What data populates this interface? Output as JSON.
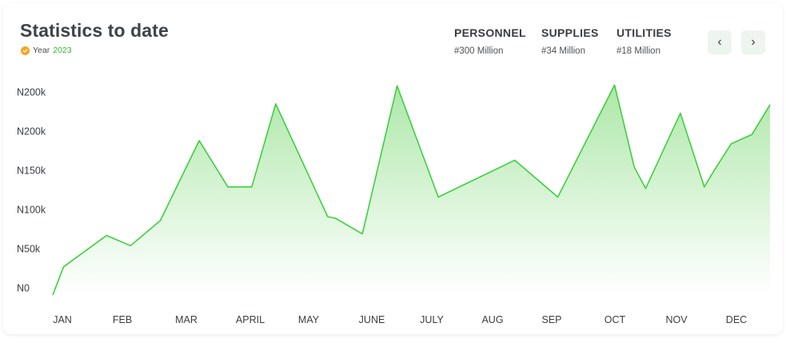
{
  "header": {
    "title": "Statistics to date",
    "year_label": "Year",
    "year_value": "2023"
  },
  "stats": [
    {
      "label": "PERSONNEL",
      "value": "#300 Million"
    },
    {
      "label": "SUPPLIES",
      "value": "#34 Million"
    },
    {
      "label": "UTILITIES",
      "value": "#18 Million"
    }
  ],
  "nav": {
    "prev": "‹",
    "next": "›"
  },
  "colors": {
    "line": "#3fcf3f",
    "fill_top": "#a8e6a3",
    "fill_bottom": "#ffffff",
    "accent_year": "#2eb82e",
    "badge": "#f5a623"
  },
  "chart_data": {
    "type": "area",
    "y_tick_labels": [
      "N0",
      "N50k",
      "N100k",
      "N150k",
      "N200k",
      "N200k"
    ],
    "y_tick_values": [
      0,
      50000,
      100000,
      150000,
      200000,
      250000
    ],
    "ylim": [
      0,
      250000
    ],
    "categories": [
      "JAN",
      "FEB",
      "MAR",
      "APRIL",
      "MAY",
      "JUNE",
      "JULY",
      "AUG",
      "SEP",
      "OCT",
      "NOV",
      "DEC"
    ],
    "x_range": [
      0,
      12
    ],
    "grid": false,
    "points": [
      [
        0.0,
        0
      ],
      [
        0.18,
        36000
      ],
      [
        0.9,
        76000
      ],
      [
        1.3,
        63000
      ],
      [
        1.8,
        95000
      ],
      [
        2.45,
        197000
      ],
      [
        2.93,
        138000
      ],
      [
        3.33,
        138000
      ],
      [
        3.73,
        244000
      ],
      [
        4.6,
        100000
      ],
      [
        4.73,
        98000
      ],
      [
        5.18,
        78000
      ],
      [
        5.76,
        267000
      ],
      [
        6.45,
        125000
      ],
      [
        7.73,
        172000
      ],
      [
        8.45,
        125000
      ],
      [
        9.4,
        268000
      ],
      [
        9.73,
        163000
      ],
      [
        9.92,
        136000
      ],
      [
        10.5,
        232000
      ],
      [
        10.9,
        138000
      ],
      [
        11.05,
        157000
      ],
      [
        11.35,
        193000
      ],
      [
        11.7,
        205000
      ],
      [
        12.0,
        243000
      ]
    ]
  }
}
